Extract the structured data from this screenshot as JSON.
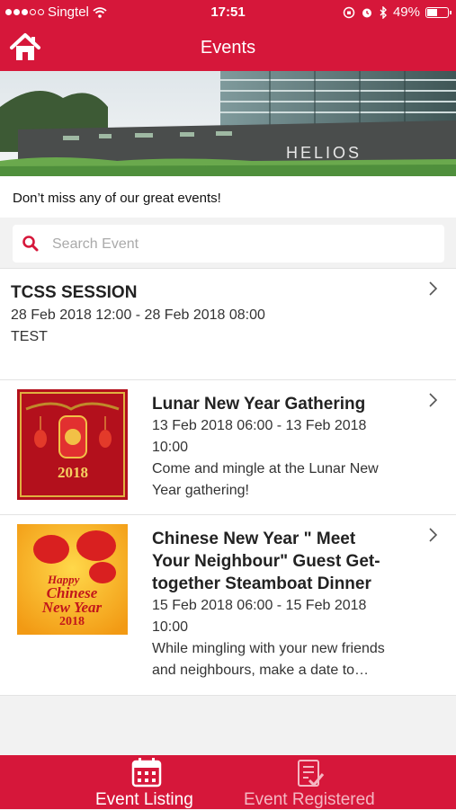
{
  "status": {
    "carrier": "Singtel",
    "time": "17:51",
    "battery": "49%"
  },
  "nav": {
    "title": "Events",
    "home_icon": "home-icon"
  },
  "banner": {
    "sign_text": "HELIOS"
  },
  "tagline": "Don’t miss any of our great events!",
  "search": {
    "placeholder": "Search Event",
    "value": ""
  },
  "events": [
    {
      "title": "TCSS SESSION",
      "date": "28 Feb 2018 12:00 - 28 Feb 2018 08:00",
      "desc": "TEST"
    },
    {
      "title": "Lunar New Year Gathering",
      "date_line1": "13 Feb 2018 06:00 - 13 Feb 2018",
      "date_line2": "10:00",
      "desc_line1": "Come and mingle at the Lunar New",
      "desc_line2": "Year gathering!",
      "thumb_text": "2018"
    },
    {
      "title_line1": "Chinese New Year \" Meet",
      "title_line2": "Your Neighbour\" Guest Get-",
      "title_line3": "together Steamboat Dinner",
      "date_line1": "15 Feb 2018 06:00 - 15 Feb 2018",
      "date_line2": "10:00",
      "desc_line1": "While mingling with your new friends",
      "desc_line2": "and neighbours, make a date to…",
      "thumb_line1": "Happy",
      "thumb_line2": "Chinese",
      "thumb_line3": "New Year",
      "thumb_line4": "2018"
    }
  ],
  "tabs": [
    {
      "label": "Event Listing",
      "icon": "calendar-icon",
      "active": true
    },
    {
      "label": "Event Registered",
      "icon": "checklist-icon",
      "active": false
    }
  ],
  "colors": {
    "brand": "#d6173a",
    "background": "#f2f2f2"
  }
}
